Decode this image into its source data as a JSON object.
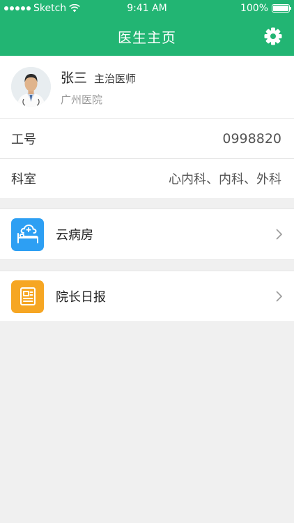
{
  "status_bar": {
    "carrier": "Sketch",
    "time": "9:41 AM",
    "battery": "100%"
  },
  "nav": {
    "title": "医生主页",
    "settings_icon": "gear-icon"
  },
  "profile": {
    "name": "张三",
    "title": "主治医师",
    "hospital": "广州医院"
  },
  "info_rows": [
    {
      "label": "工号",
      "value": "0998820"
    },
    {
      "label": "科室",
      "value": "心内科、内科、外科"
    }
  ],
  "menu": [
    {
      "label": "云病房",
      "icon": "hospital-bed-icon",
      "color": "#2d9ff3"
    },
    {
      "label": "院长日报",
      "icon": "report-icon",
      "color": "#f6a623"
    }
  ],
  "colors": {
    "primary": "#22b573",
    "background": "#f0f0f0"
  }
}
